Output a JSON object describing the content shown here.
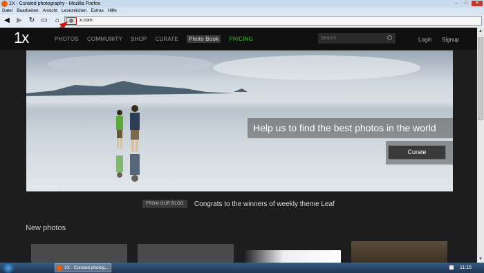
{
  "window": {
    "title": "1X - Curated photography - Mozilla Firefox"
  },
  "menu": [
    "Datei",
    "Bearbeiten",
    "Ansicht",
    "Lesezeichen",
    "Extras",
    "Hilfe"
  ],
  "address_bar": {
    "url": "x.com"
  },
  "site": {
    "logo": "1x",
    "nav": [
      "PHOTOS",
      "COMMUNITY",
      "SHOP",
      "CURATE",
      "Photo Book",
      "PRICING"
    ],
    "search_placeholder": "Search",
    "login": "Login",
    "signup": "Signup"
  },
  "hero": {
    "headline": "Help us to find the best photos in the world",
    "button": "Curate",
    "credit": "© Takeo Watanabe"
  },
  "blog": {
    "tag": "FROM OUR BLOG",
    "text": "Congrats to the winners of weekly theme Leaf"
  },
  "section": {
    "title": "New photos"
  },
  "taskbar": {
    "task_label": "1X - Curated photog...",
    "clock": "11:15"
  },
  "colors": {
    "pricing": "#3fc13f",
    "page_bg": "#1d1d1d",
    "nav_bg": "#0f0f0f"
  }
}
